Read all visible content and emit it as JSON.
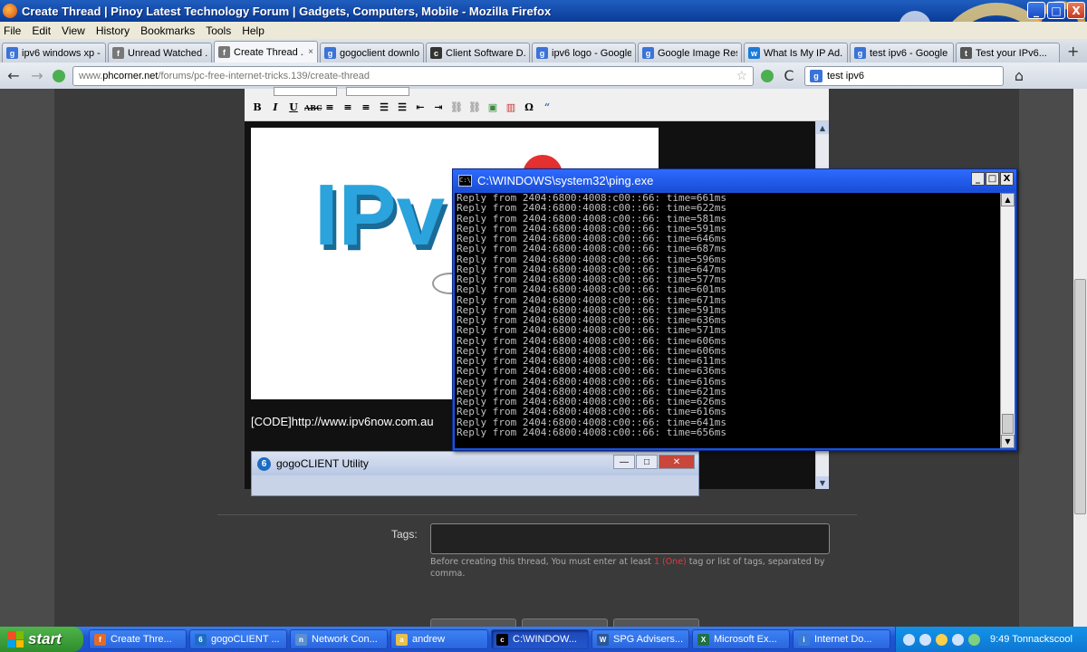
{
  "window": {
    "title": "Create Thread | Pinoy Latest Technology Forum | Gadgets, Computers, Mobile - Mozilla Firefox",
    "min": "_",
    "max": "□",
    "close": "X"
  },
  "menu": [
    "File",
    "Edit",
    "View",
    "History",
    "Bookmarks",
    "Tools",
    "Help"
  ],
  "tabs": [
    {
      "label": "ipv6 windows xp - ...",
      "icon": "g"
    },
    {
      "label": "Unread Watched ...",
      "icon": "f"
    },
    {
      "label": "Create Thread ...",
      "icon": "f",
      "close": "×"
    },
    {
      "label": "gogoclient downlo...",
      "icon": "g"
    },
    {
      "label": "Client Software D...",
      "icon": "c"
    },
    {
      "label": "ipv6 logo - Google ...",
      "icon": "g"
    },
    {
      "label": "Google Image Res...",
      "icon": "g"
    },
    {
      "label": "What Is My IP Ad...",
      "icon": "w"
    },
    {
      "label": "test ipv6 - Google ...",
      "icon": "g"
    },
    {
      "label": "Test your IPv6...",
      "icon": "t"
    }
  ],
  "newtab": "+",
  "nav": {
    "back": "←",
    "forward": "→",
    "reload": "C",
    "home": "⌂",
    "url_prefix": "www.",
    "url_host": "phcorner.net",
    "url_path": "/forums/pc-free-internet-tricks.139/create-thread",
    "search_value": "test ipv6",
    "star": "☆"
  },
  "editor": {
    "toolbar": [
      "B",
      "I",
      "U",
      "ABC",
      "≡",
      "≡",
      "≡",
      "☰",
      "☰",
      "⇤",
      "⇥",
      "⛓",
      "⛓",
      "▣",
      "▥",
      "Ω",
      "“"
    ],
    "image_text": "IPv",
    "code_line": "[CODE]http://www.ipv6now.com.au",
    "gogo_title": "gogoCLIENT Utility",
    "gogo_btns": [
      "—",
      "□",
      "✕"
    ],
    "scroll_up": "▲",
    "scroll_down": "▼"
  },
  "cmd": {
    "title": "C:\\WINDOWS\\system32\\ping.exe",
    "icon_text": "C:\\",
    "btns": [
      "_",
      "□",
      "X"
    ],
    "lines": [
      "Reply from 2404:6800:4008:c00::66: time=661ms",
      "Reply from 2404:6800:4008:c00::66: time=622ms",
      "Reply from 2404:6800:4008:c00::66: time=581ms",
      "Reply from 2404:6800:4008:c00::66: time=591ms",
      "Reply from 2404:6800:4008:c00::66: time=646ms",
      "Reply from 2404:6800:4008:c00::66: time=687ms",
      "Reply from 2404:6800:4008:c00::66: time=596ms",
      "Reply from 2404:6800:4008:c00::66: time=647ms",
      "Reply from 2404:6800:4008:c00::66: time=577ms",
      "Reply from 2404:6800:4008:c00::66: time=601ms",
      "Reply from 2404:6800:4008:c00::66: time=671ms",
      "Reply from 2404:6800:4008:c00::66: time=591ms",
      "Reply from 2404:6800:4008:c00::66: time=636ms",
      "Reply from 2404:6800:4008:c00::66: time=571ms",
      "Reply from 2404:6800:4008:c00::66: time=606ms",
      "Reply from 2404:6800:4008:c00::66: time=606ms",
      "Reply from 2404:6800:4008:c00::66: time=611ms",
      "Reply from 2404:6800:4008:c00::66: time=636ms",
      "Reply from 2404:6800:4008:c00::66: time=616ms",
      "Reply from 2404:6800:4008:c00::66: time=621ms",
      "Reply from 2404:6800:4008:c00::66: time=626ms",
      "Reply from 2404:6800:4008:c00::66: time=616ms",
      "Reply from 2404:6800:4008:c00::66: time=641ms",
      "Reply from 2404:6800:4008:c00::66: time=656ms"
    ]
  },
  "tags": {
    "label": "Tags:",
    "value": "",
    "hint_before": "Before creating this thread, You must enter at least ",
    "hint_red": "1 (One)",
    "hint_after": " tag or list of tags, separated by comma."
  },
  "taskbar": {
    "start": "start",
    "tasks": [
      {
        "label": "Create Thre...",
        "icon": "f"
      },
      {
        "label": "gogoCLIENT ...",
        "icon": "6"
      },
      {
        "label": "Network Con...",
        "icon": "n"
      },
      {
        "label": "andrew",
        "icon": "a"
      },
      {
        "label": "C:\\WINDOW...",
        "icon": "c",
        "active": true
      },
      {
        "label": "SPG Advisers...",
        "icon": "W"
      },
      {
        "label": "Microsoft Ex...",
        "icon": "X"
      },
      {
        "label": "Internet Do...",
        "icon": "i"
      }
    ],
    "clock": "9:49 Tonnackscool"
  },
  "colors": {
    "accent": "#2ba3dc",
    "danger": "#e03a3a",
    "xp_blue": "#1f56d4"
  }
}
